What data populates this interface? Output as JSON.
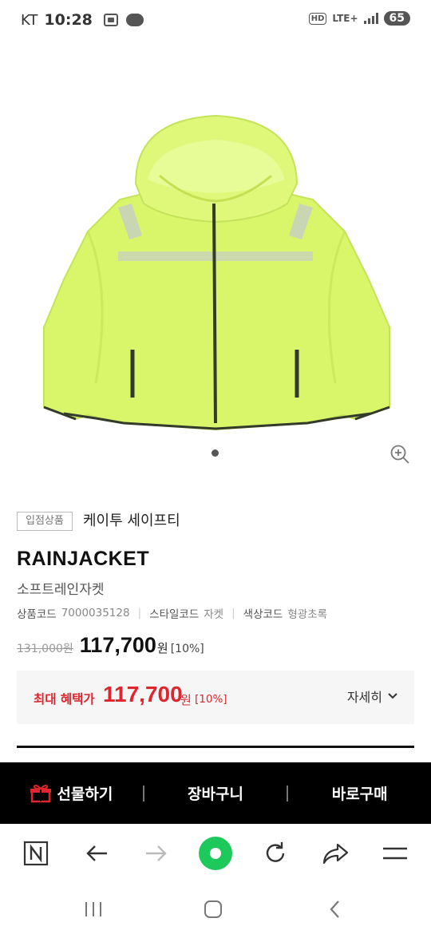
{
  "status_bar": {
    "carrier": "KT",
    "time": "10:28",
    "hd": "HD",
    "network": "LTE+",
    "battery": "65"
  },
  "product": {
    "image_icon": "rain-jacket-image",
    "store_badge": "입점상품",
    "brand": "케이투 세이프티",
    "title": "RAINJACKET",
    "subtitle": "소프트레인자켓",
    "codes": {
      "product_code_label": "상품코드",
      "product_code": "7000035128",
      "style_code_label": "스타일코드",
      "style_code": "자켓",
      "color_code_label": "색상코드",
      "color_code": "형광초록"
    },
    "price": {
      "original": "131,000원",
      "sale": "117,700",
      "won": "원",
      "discount": "[10%]"
    },
    "benefit": {
      "label": "최대 혜택가",
      "price": "117,700",
      "won": "원",
      "discount": "[10%]",
      "detail": "자세히"
    }
  },
  "purchase_bar": {
    "gift": "선물하기",
    "cart": "장바구니",
    "buy_now": "바로구매"
  },
  "colors": {
    "accent_red": "#e0262d",
    "neon_green": "#d9f66a",
    "browser_green": "#1ec95b",
    "purchase_bg": "#000000"
  },
  "icons": [
    "zoom-in-icon",
    "gift-icon",
    "chevron-down-icon",
    "naver-n-icon",
    "back-arrow-icon",
    "forward-arrow-icon",
    "home-green-icon",
    "refresh-icon",
    "share-icon",
    "menu-icon",
    "recent-apps-icon",
    "home-icon",
    "back-icon"
  ]
}
